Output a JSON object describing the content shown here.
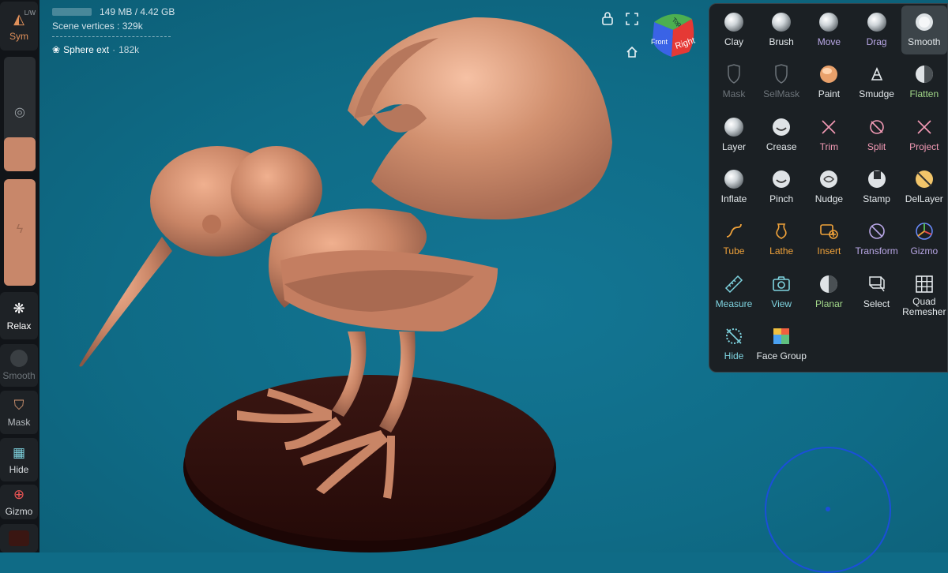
{
  "left_bar": {
    "top_badge": "L/W",
    "sym_label": "Sym",
    "relax_label": "Relax",
    "smooth_label": "Smooth",
    "mask_label": "Mask",
    "hide_label": "Hide",
    "gizmo_label": "Gizmo",
    "radius_level": 0.3,
    "intensity_level": 1.0
  },
  "info": {
    "memory": "149 MB / 4.42 GB",
    "memory_level": 0.03,
    "vertices": "Scene vertices : 329k",
    "mesh_name": "Sphere ext",
    "mesh_vertices": "182k"
  },
  "view_cube": {
    "front": "Front",
    "right": "Right",
    "top": "Top"
  },
  "tools": [
    {
      "label": "Clay",
      "icon": "clay-sphere-icon",
      "color": "white"
    },
    {
      "label": "Brush",
      "icon": "brush-sphere-icon",
      "color": "white"
    },
    {
      "label": "Move",
      "icon": "move-sphere-icon",
      "color": "purple"
    },
    {
      "label": "Drag",
      "icon": "drag-sphere-icon",
      "color": "purple"
    },
    {
      "label": "Smooth",
      "icon": "smooth-icon",
      "color": "white"
    },
    {
      "label": "Mask",
      "icon": "mask-icon",
      "color": "dim"
    },
    {
      "label": "SelMask",
      "icon": "selmask-icon",
      "color": "dim"
    },
    {
      "label": "Paint",
      "icon": "paint-icon",
      "color": "white"
    },
    {
      "label": "Smudge",
      "icon": "smudge-icon",
      "color": "white"
    },
    {
      "label": "Flatten",
      "icon": "flatten-icon",
      "color": "green"
    },
    {
      "label": "Layer",
      "icon": "layer-icon",
      "color": "white"
    },
    {
      "label": "Crease",
      "icon": "crease-icon",
      "color": "white"
    },
    {
      "label": "Trim",
      "icon": "trim-icon",
      "color": "pink"
    },
    {
      "label": "Split",
      "icon": "split-icon",
      "color": "pink"
    },
    {
      "label": "Project",
      "icon": "project-icon",
      "color": "pink"
    },
    {
      "label": "Inflate",
      "icon": "inflate-icon",
      "color": "white"
    },
    {
      "label": "Pinch",
      "icon": "pinch-icon",
      "color": "white"
    },
    {
      "label": "Nudge",
      "icon": "nudge-icon",
      "color": "white"
    },
    {
      "label": "Stamp",
      "icon": "stamp-icon",
      "color": "white"
    },
    {
      "label": "DelLayer",
      "icon": "dellayer-icon",
      "color": "white"
    },
    {
      "label": "Tube",
      "icon": "tube-icon",
      "color": "orange"
    },
    {
      "label": "Lathe",
      "icon": "lathe-icon",
      "color": "orange"
    },
    {
      "label": "Insert",
      "icon": "insert-icon",
      "color": "orange"
    },
    {
      "label": "Transform",
      "icon": "transform-icon",
      "color": "purple"
    },
    {
      "label": "Gizmo",
      "icon": "gizmo-icon",
      "color": "purple"
    },
    {
      "label": "Measure",
      "icon": "measure-icon",
      "color": "cyan"
    },
    {
      "label": "View",
      "icon": "camera-icon",
      "color": "cyan"
    },
    {
      "label": "Planar",
      "icon": "planar-icon",
      "color": "green"
    },
    {
      "label": "Select",
      "icon": "select-icon",
      "color": "white"
    },
    {
      "label": "Quad Remesher",
      "icon": "grid-icon",
      "color": "white"
    },
    {
      "label": "Hide",
      "icon": "hide-icon",
      "color": "cyan"
    },
    {
      "label": "Face Group",
      "icon": "facegroup-icon",
      "color": "white"
    }
  ],
  "selected_tool": "Smooth"
}
